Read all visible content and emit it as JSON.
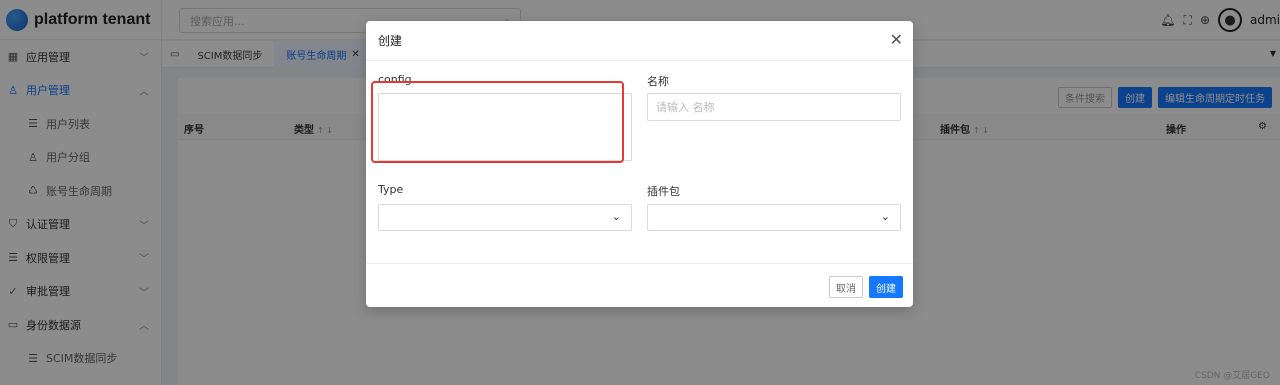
{
  "app": {
    "title": "platform tenant"
  },
  "header": {
    "search_placeholder": "搜索应用...",
    "icons": [
      "bell-icon",
      "fullscreen-icon",
      "globe-icon"
    ],
    "user_name": "admi"
  },
  "sidebar": {
    "items": [
      {
        "label": "应用管理",
        "icon": "apps-icon",
        "expanded": false
      },
      {
        "label": "用户管理",
        "icon": "user-icon",
        "expanded": true,
        "active": true
      },
      {
        "label": "用户列表",
        "icon": "list-icon",
        "sub": true
      },
      {
        "label": "用户分组",
        "icon": "user-icon",
        "sub": true
      },
      {
        "label": "账号生命周期",
        "icon": "recycle-icon",
        "sub": true
      },
      {
        "label": "认证管理",
        "icon": "shield-icon",
        "expanded": false
      },
      {
        "label": "权限管理",
        "icon": "list-icon",
        "expanded": false
      },
      {
        "label": "审批管理",
        "icon": "check-icon",
        "expanded": false
      },
      {
        "label": "身份数据源",
        "icon": "database-icon",
        "expanded": true
      },
      {
        "label": "SCIM数据同步",
        "icon": "list-icon",
        "sub": true
      }
    ]
  },
  "tabs": [
    {
      "label": "SCIM数据同步",
      "active": false
    },
    {
      "label": "账号生命周期",
      "active": true
    }
  ],
  "toolbar": {
    "filter_label": "条件搜索",
    "create_label": "创建",
    "edit_schedule_label": "编辑生命周期定时任务"
  },
  "table": {
    "columns": [
      {
        "label": "序号",
        "sortable": false
      },
      {
        "label": "类型",
        "sortable": true
      },
      {
        "label": "插件包",
        "sortable": true
      },
      {
        "label": "操作",
        "sortable": false
      }
    ]
  },
  "modal": {
    "title": "创建",
    "config_label": "config",
    "name_label": "名称",
    "name_placeholder": "请输入 名称",
    "type_label": "Type",
    "plugin_label": "插件包",
    "cancel_label": "取消",
    "ok_label": "创建"
  },
  "watermark": "CSDN @艾居GEO",
  "colors": {
    "accent": "#1677ff",
    "highlight": "#e53935"
  }
}
